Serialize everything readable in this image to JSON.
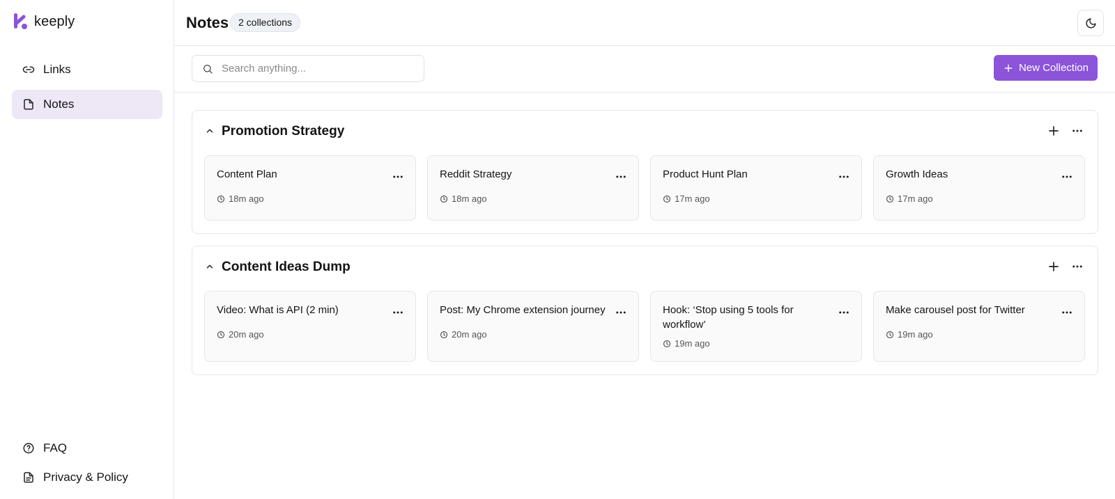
{
  "app": {
    "name": "keeply",
    "brand_color": "#8b54d9"
  },
  "sidebar": {
    "items": [
      {
        "label": "Links",
        "icon": "link-icon"
      },
      {
        "label": "Notes",
        "icon": "file-icon",
        "active": true
      }
    ],
    "bottom_items": [
      {
        "label": "FAQ",
        "icon": "help-circle-icon"
      },
      {
        "label": "Privacy & Policy",
        "icon": "document-icon"
      }
    ]
  },
  "header": {
    "title": "Notes",
    "count_badge": "2 collections",
    "theme_toggle_icon": "moon-icon"
  },
  "toolbar": {
    "search_placeholder": "Search anything...",
    "new_button": "New Collection"
  },
  "collections": [
    {
      "title": "Promotion Strategy",
      "notes": [
        {
          "title": "Content Plan",
          "time": "18m ago"
        },
        {
          "title": "Reddit Strategy",
          "time": "18m ago"
        },
        {
          "title": "Product Hunt Plan",
          "time": "17m ago"
        },
        {
          "title": "Growth Ideas",
          "time": "17m ago"
        }
      ]
    },
    {
      "title": "Content Ideas Dump",
      "notes": [
        {
          "title": "Video: What is API (2 min)",
          "time": "20m ago"
        },
        {
          "title": "Post: My Chrome extension journey",
          "time": "20m ago"
        },
        {
          "title": "Hook: ‘Stop using 5 tools for workflow’",
          "time": "19m ago"
        },
        {
          "title": "Make carousel post for Twitter",
          "time": "19m ago"
        }
      ]
    }
  ]
}
